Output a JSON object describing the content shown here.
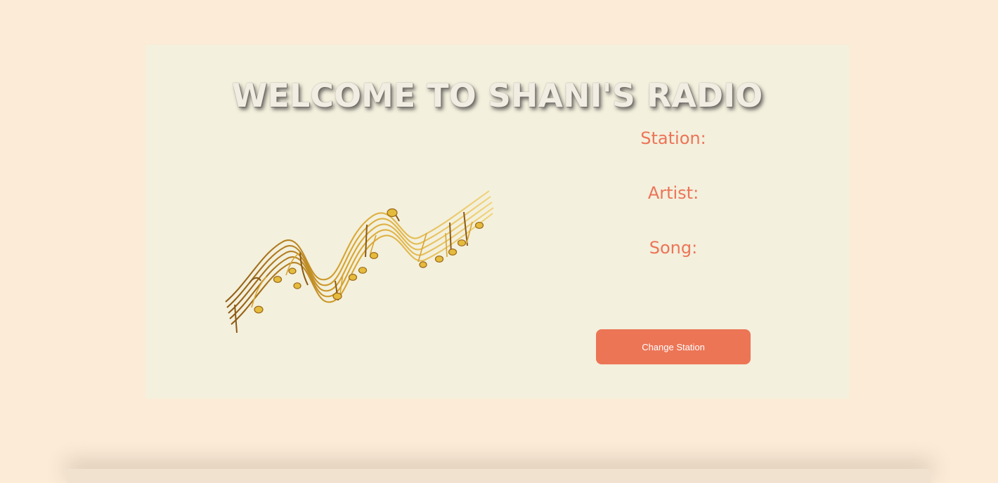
{
  "header": {
    "title": "WELCOME TO SHANI'S RADIO"
  },
  "illustration": {
    "icon": "music-staff-notes-icon",
    "colors": {
      "gold": "#e1b64b",
      "brown": "#a26417"
    }
  },
  "info": {
    "station_label": "Station:",
    "artist_label": "Artist:",
    "song_label": "Song:"
  },
  "actions": {
    "change_station_label": "Change Station"
  },
  "theme": {
    "page_bg": "#fbebd7",
    "panel_bg": "#f3f0dd",
    "accent": "#ec7556"
  }
}
